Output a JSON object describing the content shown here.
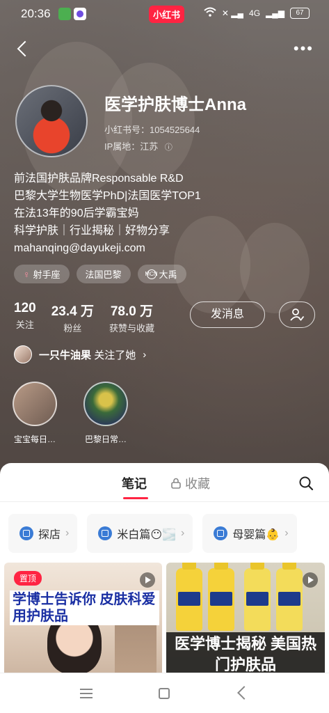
{
  "status_bar": {
    "time": "20:36",
    "brand": "小红书",
    "network": "4G",
    "battery": "67"
  },
  "profile": {
    "name": "医学护肤博士Anna",
    "id_line": "小红书号：1054525644",
    "ip_line": "IP属地：江苏",
    "bio": [
      "前法国护肤品牌Responsable R&D",
      "巴黎大学生物医学PhD|法国医学TOP1",
      "在法13年的90后学霸宝妈",
      "科学护肤｜行业揭秘｜好物分享",
      "mahanqing@dayukeji.com"
    ],
    "tags": [
      "射手座",
      "法国巴黎",
      "大禹"
    ]
  },
  "stats": [
    {
      "value": "120",
      "label": "关注"
    },
    {
      "value": "23.4 万",
      "label": "粉丝"
    },
    {
      "value": "78.0 万",
      "label": "获赞与收藏"
    }
  ],
  "actions": {
    "message": "发消息"
  },
  "followed_by": {
    "name": "一只牛油果",
    "suffix": "关注了她"
  },
  "collections": [
    {
      "label": "宝宝每日…"
    },
    {
      "label": "巴黎日常…"
    }
  ],
  "tabs": {
    "notes": "笔记",
    "collect": "收藏"
  },
  "chips": [
    "探店",
    "米白篇😶🌫️",
    "母婴篇👶"
  ],
  "cards": [
    {
      "badge": "置顶",
      "title": "学博士告诉你 皮肤科爱用护肤品"
    },
    {
      "title": "医学博士揭秘 美国热门护肤品"
    }
  ],
  "colors": {
    "brand": "#ff2442",
    "accent_blue": "#3a7bd5"
  }
}
